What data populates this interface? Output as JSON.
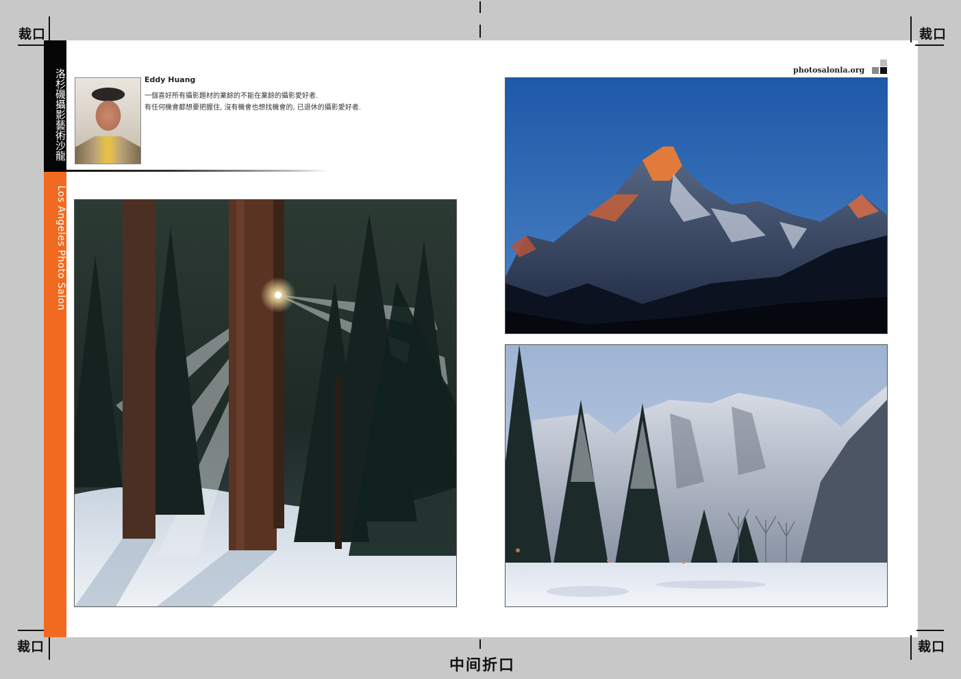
{
  "crop_marks": {
    "top_left": "裁口",
    "top_right": "裁口",
    "bottom_left": "裁口",
    "bottom_right": "裁口",
    "fold": "中间折口"
  },
  "spine": {
    "chinese_title": "洛杉磯攝影藝術沙龍",
    "english_title": "Los Angeles Photo Salon",
    "colors": {
      "top": "#050505",
      "bottom": "#f26a1f"
    }
  },
  "author": {
    "name": "Eddy Huang",
    "bio_line_1": "一個喜好所有攝影題材的業餘的不能在業餘的攝影愛好者.",
    "bio_line_2": "有任何機會都想要把握住, 沒有機會也想找機會的, 已退休的攝影愛好者."
  },
  "site": {
    "url": "photosalonla.org"
  },
  "photos": {
    "forest": "forest-sunbeam-photo",
    "mountain": "mountain-peak-photo",
    "valley": "snowy-valley-photo"
  }
}
